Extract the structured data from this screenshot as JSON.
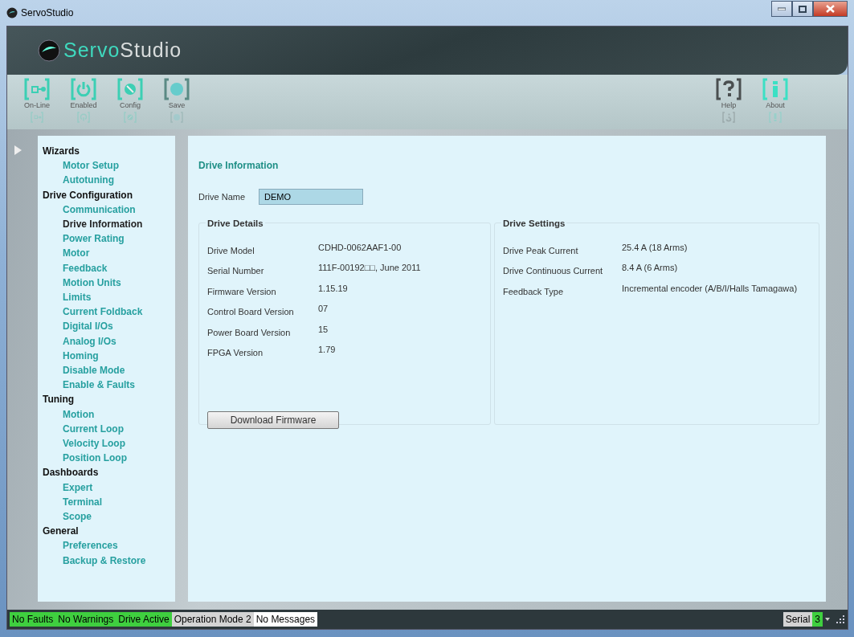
{
  "window": {
    "title": "ServoStudio"
  },
  "banner": {
    "logo_text_1": "Servo",
    "logo_text_2": "Studio"
  },
  "toolbar": {
    "left": [
      {
        "label": "On-Line",
        "kind": "online",
        "color": "#3ccfb4"
      },
      {
        "label": "Enabled",
        "kind": "power",
        "color": "#3ccfb4"
      },
      {
        "label": "Config",
        "kind": "config",
        "color": "#3ccfb4"
      },
      {
        "label": "Save",
        "kind": "save",
        "color": "#5a8a84"
      }
    ],
    "right": [
      {
        "label": "Help",
        "kind": "help",
        "color": "#4a4f50"
      },
      {
        "label": "About",
        "kind": "about",
        "color": "#3ce0c4"
      }
    ]
  },
  "sidebar": {
    "groups": [
      {
        "label": "Wizards",
        "children": [
          {
            "label": "Motor Setup",
            "selected": false
          },
          {
            "label": "Autotuning",
            "selected": false
          }
        ]
      },
      {
        "label": "Drive Configuration",
        "children": [
          {
            "label": "Communication",
            "selected": false
          },
          {
            "label": "Drive Information",
            "selected": true
          },
          {
            "label": "Power Rating",
            "selected": false
          },
          {
            "label": "Motor",
            "selected": false
          },
          {
            "label": "Feedback",
            "selected": false
          },
          {
            "label": "Motion Units",
            "selected": false
          },
          {
            "label": "Limits",
            "selected": false
          },
          {
            "label": "Current Foldback",
            "selected": false
          },
          {
            "label": "Digital I/Os",
            "selected": false
          },
          {
            "label": "Analog I/Os",
            "selected": false
          },
          {
            "label": "Homing",
            "selected": false
          },
          {
            "label": "Disable Mode",
            "selected": false
          },
          {
            "label": "Enable & Faults",
            "selected": false
          }
        ]
      },
      {
        "label": "Tuning",
        "children": [
          {
            "label": "Motion",
            "selected": false
          },
          {
            "label": "Current Loop",
            "selected": false
          },
          {
            "label": "Velocity Loop",
            "selected": false
          },
          {
            "label": "Position Loop",
            "selected": false
          }
        ]
      },
      {
        "label": "Dashboards",
        "children": [
          {
            "label": "Expert",
            "selected": false
          },
          {
            "label": "Terminal",
            "selected": false
          },
          {
            "label": "Scope",
            "selected": false
          }
        ]
      },
      {
        "label": "General",
        "children": [
          {
            "label": "Preferences",
            "selected": false
          },
          {
            "label": "Backup & Restore",
            "selected": false
          }
        ]
      }
    ]
  },
  "content": {
    "title": "Drive Information",
    "drive_name": {
      "label": "Drive Name",
      "value": "DEMO"
    },
    "drive_details": {
      "title": "Drive Details",
      "rows": [
        {
          "label": "Drive Model",
          "value": "CDHD-0062AAF1-00"
        },
        {
          "label": "Serial Number",
          "value": "111F-00192□□, June 2011"
        },
        {
          "label": "Firmware Version",
          "value": "1.15.19"
        },
        {
          "label": "Control Board Version",
          "value": "07"
        },
        {
          "label": "Power Board Version",
          "value": "15"
        },
        {
          "label": "FPGA Version",
          "value": "1.79"
        }
      ],
      "button": "Download Firmware"
    },
    "drive_settings": {
      "title": "Drive Settings",
      "rows": [
        {
          "label": "Drive Peak Current",
          "value": "25.4  A (18 Arms)"
        },
        {
          "label": "Drive Continuous Current",
          "value": "8.4  A (6 Arms)"
        },
        {
          "label": "Feedback Type",
          "value": "Incremental encoder (A/B/I/Halls Tamagawa)"
        }
      ]
    }
  },
  "status_bar": {
    "left": [
      {
        "text": "No Faults",
        "color": "#3fcf3f"
      },
      {
        "text": "No Warnings",
        "color": "#3fcf3f"
      },
      {
        "text": "Drive Active",
        "color": "#3fcf3f"
      },
      {
        "text": "Operation Mode 2",
        "color": "#d4d4d4"
      },
      {
        "text": "No Messages",
        "color": "#ffffff"
      }
    ],
    "right": [
      {
        "text": "Serial",
        "color": "#d4d4d4"
      },
      {
        "text": "3",
        "color": "#3fcf3f"
      }
    ]
  }
}
